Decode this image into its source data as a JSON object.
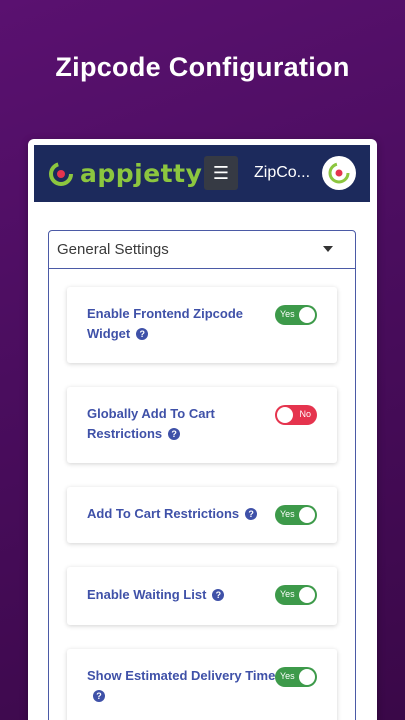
{
  "promo": {
    "title": "Zipcode Configuration"
  },
  "header": {
    "logo_text": "appjetty",
    "title": "ZipCo...",
    "menu_icon": "hamburger-icon"
  },
  "settings": {
    "section_label": "General Settings",
    "items": [
      {
        "label": "Enable Frontend Zipcode Widget",
        "toggle_text": "Yes",
        "enabled": true
      },
      {
        "label": "Globally Add To Cart Restrictions",
        "toggle_text": "No",
        "enabled": false
      },
      {
        "label": "Add To Cart Restrictions",
        "toggle_text": "Yes",
        "enabled": true
      },
      {
        "label": "Enable Waiting List",
        "toggle_text": "Yes",
        "enabled": true
      },
      {
        "label": "Show Estimated Delivery Time",
        "toggle_text": "Yes",
        "enabled": true
      }
    ]
  },
  "colors": {
    "background": "#4a0d5e",
    "header": "#1c2a5c",
    "accent": "#3f51a8",
    "toggle_on": "#3d9a4a",
    "toggle_off": "#e5344e",
    "logo_green": "#8cc63f"
  }
}
